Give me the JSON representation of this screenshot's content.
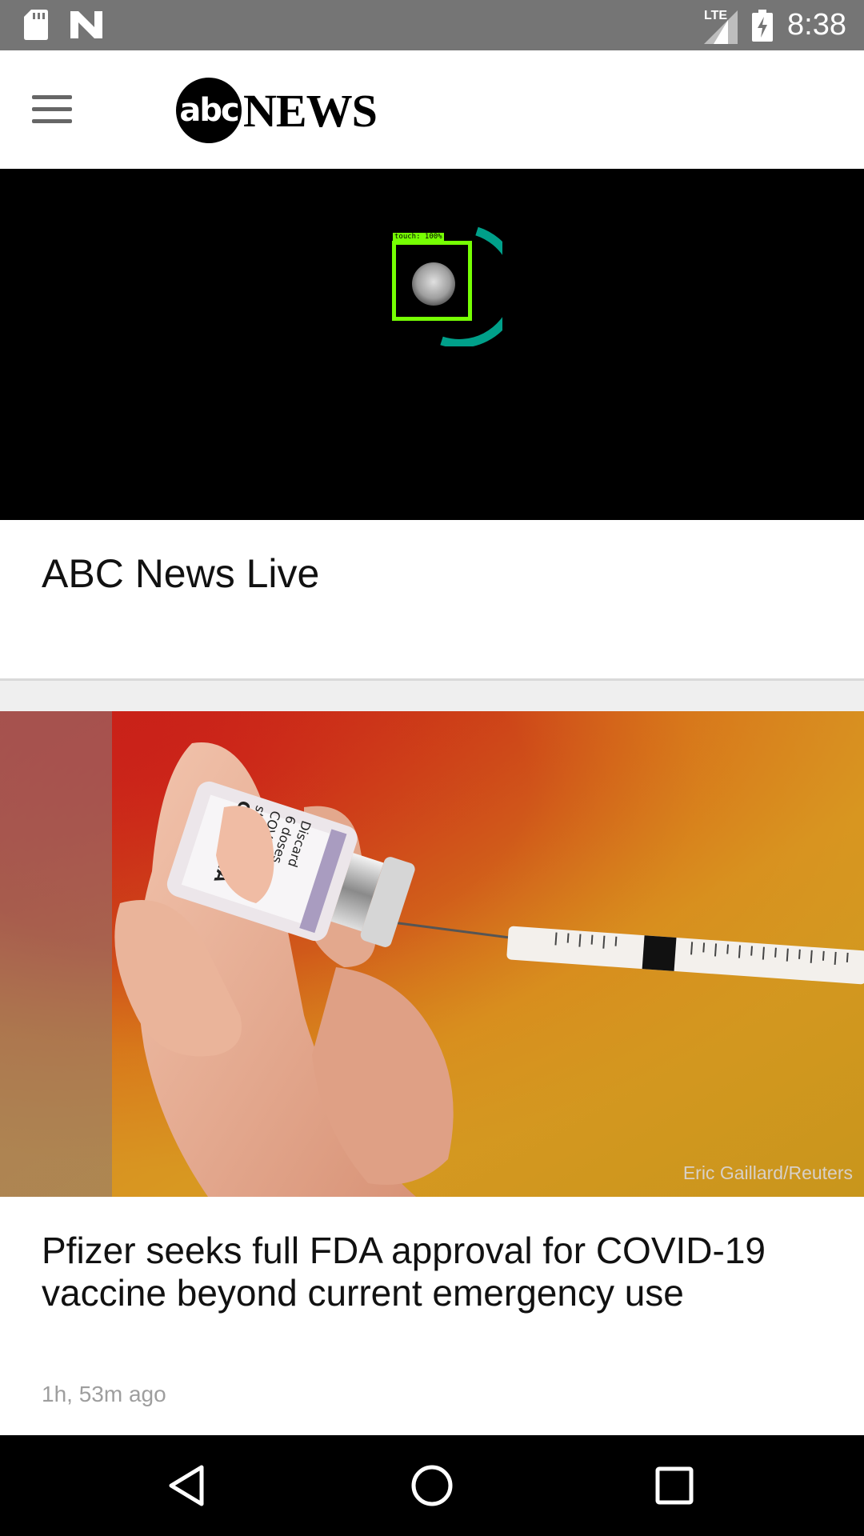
{
  "status_bar": {
    "time": "8:38",
    "network": "LTE",
    "icons": [
      "sd-card-icon",
      "n-notification-icon",
      "signal-icon",
      "battery-charging-icon"
    ]
  },
  "app_bar": {
    "logo_abc": "abc",
    "logo_news": "NEWS",
    "menu_icon": "hamburger-menu-icon"
  },
  "player": {
    "touch_label": "touch: 100%",
    "spinner_color": "#00a08a",
    "touch_box_color": "#76ff03"
  },
  "live": {
    "title": "ABC News Live"
  },
  "story": {
    "photo_credit": "Eric Gaillard/Reuters",
    "vial_label_lines": [
      "COMIRNA",
      "sterile conc",
      "COVID-19",
      "6 doses",
      "Discard"
    ],
    "title": "Pfizer seeks full FDA approval for COVID-19 vaccine beyond current emergency use",
    "time_ago": "1h, 53m ago"
  },
  "nav_bar": {
    "icons": [
      "back-icon",
      "home-icon",
      "recents-icon"
    ]
  }
}
